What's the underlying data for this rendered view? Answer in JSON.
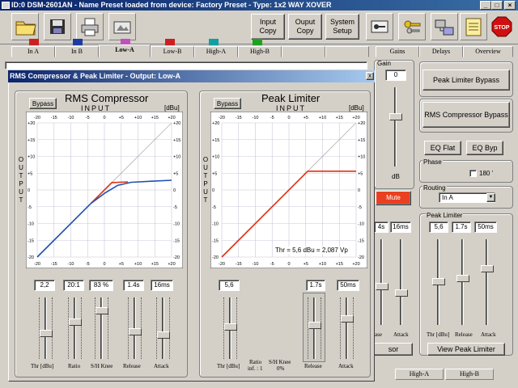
{
  "window": {
    "title": "ID:0 DSM-2601AN - Name Preset loaded from device: Factory Preset - Type: 1x2 WAY XOVER",
    "min": "_",
    "max": "□",
    "close": "×"
  },
  "toolbar": {
    "input_copy": "Input Copy",
    "output_copy": "Ouput Copy",
    "system_setup": "System Setup",
    "stop": "STOP"
  },
  "tabs": [
    {
      "label": "In A",
      "color": "#cc2020"
    },
    {
      "label": "In B",
      "color": "#1f3aa0"
    },
    {
      "label": "Low-A",
      "color": "#c050c0",
      "active": true
    },
    {
      "label": "Low-B",
      "color": "#cc2020"
    },
    {
      "label": "High-A",
      "color": "#10a0a0"
    },
    {
      "label": "High-B",
      "color": "#20a020"
    }
  ],
  "right_tabs": [
    "Gains",
    "Delays",
    "Overview"
  ],
  "gain": {
    "label": "Gain",
    "value": "0",
    "unit": "dB",
    "mute": "Mute"
  },
  "right": {
    "peak_limiter_bypass": "Peak Limiter Bypass",
    "rms_compressor_bypass": "RMS Compressor Bypass",
    "eq_flat": "EQ Flat",
    "eq_byp": "EQ Byp",
    "phase_label": "Phase",
    "phase_180": "180 '",
    "routing_label": "Routing",
    "routing_value": "In A",
    "peak_limiter_label": "Peak Limiter",
    "pl_values": [
      "5,6",
      "1.7s",
      "50ms"
    ],
    "pl_fader_labels": [
      "Thr [dBu]",
      "Release",
      "Attack"
    ],
    "view_peak_limiter": "View Peak Limiter",
    "partial_values": [
      "4s",
      "16ms"
    ],
    "partial_labels": [
      "ase",
      "Attack"
    ],
    "partial_button": "sor",
    "bottom_tabs": [
      "High-A",
      "High-B"
    ]
  },
  "dialog": {
    "title": "RMS Compressor & Peak Limiter - Output:  Low-A",
    "close": "x",
    "rms": {
      "bypass": "Bypass",
      "title": "RMS Compressor",
      "input": "INPUT",
      "unit": "[dBu]",
      "output": "OUTPUT",
      "values": [
        "2,2",
        "20:1",
        "83 %",
        "1.4s",
        "16ms"
      ],
      "fader_labels": [
        "Thr [dBu]",
        "Ratio",
        "S/H Knee",
        "Release",
        "Attack"
      ]
    },
    "pl": {
      "bypass": "Bypass",
      "title": "Peak Limiter",
      "input": "INPUT",
      "unit": "[dBu]",
      "output": "OUTPUT",
      "annotation": "Thr = 5,6 dBu = 2,087 Vp",
      "values": [
        "5,6",
        "1.7s",
        "50ms"
      ],
      "fader_labels": [
        "Thr [dBu]",
        "Ratio",
        "S/H Knee",
        "Release",
        "Attack"
      ],
      "ratio_sub": "inf. : 1",
      "knee_sub": "0%"
    },
    "ticks": [
      "-20",
      "-15",
      "-10",
      "-5",
      "0",
      "+5",
      "+10",
      "+15",
      "+20"
    ],
    "yticks": [
      "+20",
      "+15",
      "+10",
      "+5",
      "0",
      "-5",
      "-10",
      "-15",
      "-20"
    ]
  }
}
